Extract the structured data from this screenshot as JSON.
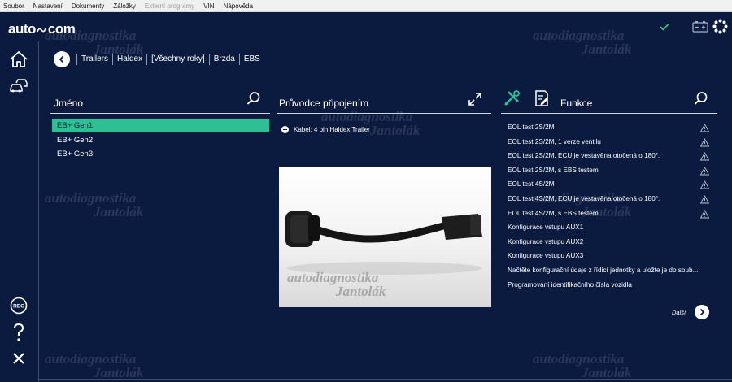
{
  "menu": [
    "Soubor",
    "Nastavení",
    "Dokumenty",
    "Záložky",
    "Externí programy",
    "VIN",
    "Nápověda"
  ],
  "menu_disabled": [
    "Externí programy"
  ],
  "logo": {
    "part1": "auto",
    "part2": "com"
  },
  "watermark": {
    "line1": "autodiagnostika",
    "line2": "Jantolák"
  },
  "breadcrumb": [
    "Trailers",
    "Haldex",
    "[Všechny roky]",
    "Brzda",
    "EBS"
  ],
  "left_panel": {
    "title": "Jméno",
    "items": [
      "EB+ Gen1",
      "EB+ Gen2",
      "EB+ Gen3"
    ],
    "selected_index": 0
  },
  "middle_panel": {
    "title": "Průvodce připojením",
    "cable_label": "Kabel: 4 pin Haldex Trailer"
  },
  "right_panel": {
    "title": "Funkce",
    "items": [
      {
        "label": "EOL test 2S/2M",
        "warn": true
      },
      {
        "label": "EOL test 2S/2M, 1 verze ventilu",
        "warn": true
      },
      {
        "label": "EOL test 2S/2M, ECU je vestavěna otočená o 180°.",
        "warn": true
      },
      {
        "label": "EOL test 2S/2M, s EBS testem",
        "warn": true
      },
      {
        "label": "EOL test 4S/2M",
        "warn": true
      },
      {
        "label": "EOL test 4S/2M, ECU je vestavěna otočená o 180°.",
        "warn": true
      },
      {
        "label": "EOL test 4S/2M, s EBS testem",
        "warn": true
      },
      {
        "label": "Konfigurace vstupu AUX1",
        "warn": false
      },
      {
        "label": "Konfigurace vstupu AUX2",
        "warn": false
      },
      {
        "label": "Konfigurace vstupu AUX3",
        "warn": false
      },
      {
        "label": "Načtěte konfigurační údaje z řídicí jednotky a uložte je do soub...",
        "warn": false
      },
      {
        "label": "Programování identifikačního čísla vozidla",
        "warn": false
      }
    ],
    "next_label": "Další"
  },
  "sidebar": {
    "rec_label": "REC"
  },
  "colors": {
    "background": "#0b1b3f",
    "accent": "#2fbf94",
    "check": "#38d17a"
  }
}
